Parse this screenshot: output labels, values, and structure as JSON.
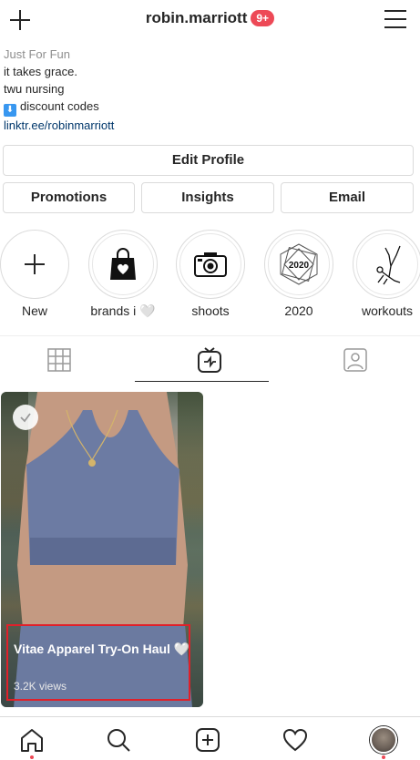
{
  "header": {
    "username": "robin.marriott",
    "notification_badge": "9+"
  },
  "bio": {
    "category": "Just For Fun",
    "lines": [
      "it takes grace.",
      "twu nursing",
      "discount codes"
    ],
    "link": "linktr.ee/robinmarriott"
  },
  "buttons": {
    "edit_profile": "Edit Profile",
    "promotions": "Promotions",
    "insights": "Insights",
    "email": "Email"
  },
  "highlights": [
    {
      "label": "New",
      "icon": "plus-icon"
    },
    {
      "label": "brands i 🤍",
      "icon": "shopping-bag-icon"
    },
    {
      "label": "shoots",
      "icon": "camera-icon"
    },
    {
      "label": "2020",
      "icon": "2020-badge-icon",
      "badge_text": "2020"
    },
    {
      "label": "workouts",
      "icon": "yoga-pose-icon"
    }
  ],
  "tabs": [
    {
      "name": "grid",
      "icon": "grid-icon",
      "active": false
    },
    {
      "name": "igtv",
      "icon": "igtv-icon",
      "active": true
    },
    {
      "name": "tagged",
      "icon": "tagged-icon",
      "active": false
    }
  ],
  "video": {
    "title": "Vitae Apparel Try-On Haul 🤍",
    "views": "3.2K views"
  },
  "bottom_nav": [
    {
      "name": "home",
      "icon": "home-icon",
      "dot": true
    },
    {
      "name": "search",
      "icon": "search-icon",
      "dot": false
    },
    {
      "name": "new-post",
      "icon": "new-post-icon",
      "dot": false
    },
    {
      "name": "activity",
      "icon": "heart-icon",
      "dot": false
    },
    {
      "name": "profile",
      "icon": "avatar",
      "dot": true
    }
  ],
  "colors": {
    "badge": "#ed4956",
    "link": "#00376b",
    "highlight_box": "#e0202a",
    "border": "#dbdbdb"
  }
}
